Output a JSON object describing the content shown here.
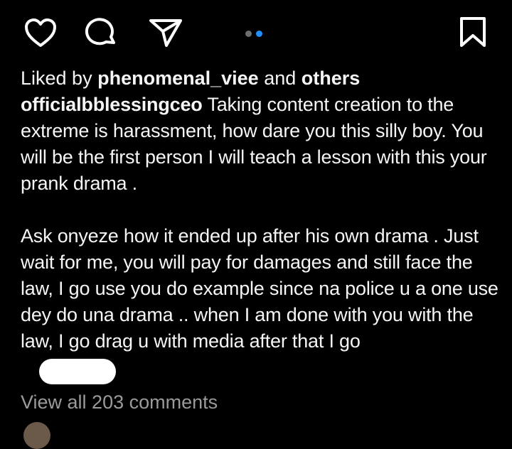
{
  "actions": {
    "like_icon": "heart-icon",
    "comment_icon": "comment-icon",
    "share_icon": "send-icon",
    "save_icon": "bookmark-icon",
    "carousel_dots": 2,
    "carousel_active_index": 1,
    "accent_color": "#1e90ff"
  },
  "likes": {
    "prefix": "Liked by",
    "user": "phenomenal_viee",
    "middle": "and",
    "others": "others"
  },
  "caption": {
    "username": "officialbblessingceo",
    "paragraph1": "Taking content creation to the extreme is harassment, how dare you this silly boy. You will be the first person I will teach a lesson with this your prank drama .",
    "paragraph2": "Ask onyeze how it ended up after his own drama . Just wait for me, you will pay for damages and still face the law, I go use you do example since na police u a one use dey do una drama .. when I am done with you with the law, I go drag u with media after that I go"
  },
  "comments": {
    "view_all_label": "View all 203 comments"
  }
}
